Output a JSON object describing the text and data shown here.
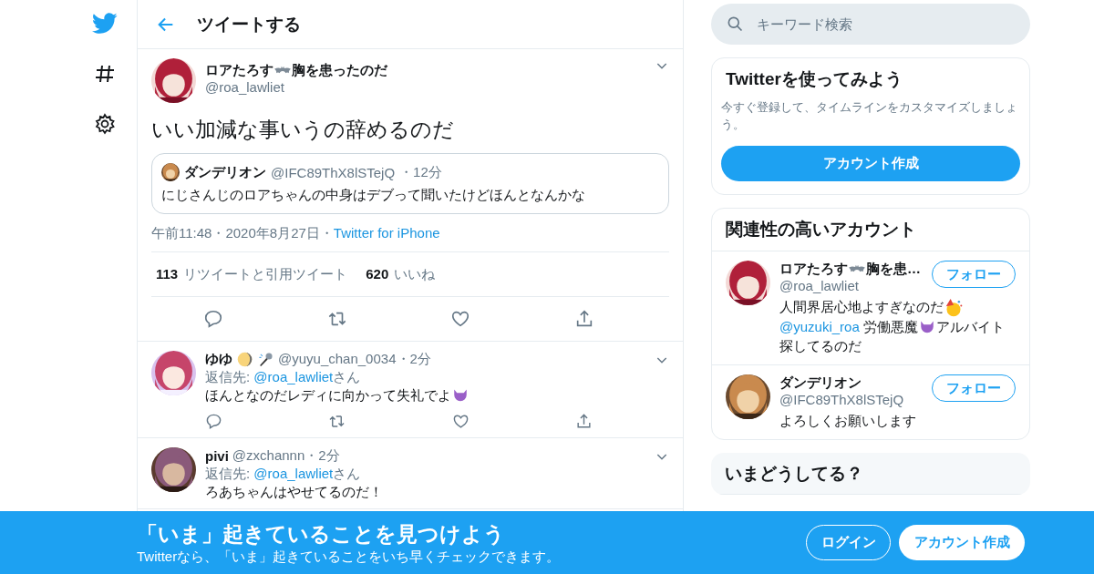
{
  "header": {
    "title": "ツイートする"
  },
  "tweet": {
    "name": "ロアたろす",
    "name_suffix": "胸を患ったのだ",
    "handle": "@roa_lawliet",
    "text": "いい加減な事いうの辞めるのだ",
    "quote": {
      "name": "ダンデリオン",
      "handle": "@IFC89ThX8lSTejQ",
      "time": "・12分",
      "text": "にじさんじのロアちゃんの中身はデブって聞いたけどほんとなんかな"
    },
    "time": "午前11:48",
    "date": "・2020年8月27日・",
    "source": "Twitter for iPhone",
    "stats": [
      {
        "count": "113",
        "label": "リツイートと引用ツイート"
      },
      {
        "count": "620",
        "label": "いいね"
      }
    ]
  },
  "replies": [
    {
      "name": "ゆゆ",
      "handle": "@yuyu_chan_0034",
      "time": "・2分",
      "reply_label": "返信先: ",
      "reply_to": "@roa_lawliet",
      "reply_suffix": "さん",
      "text": "ほんとなのだレディに向かって失礼でよ",
      "actions": true
    },
    {
      "name": "pivi",
      "handle": "@zxchannn",
      "time": "・2分",
      "reply_label": "返信先: ",
      "reply_to": "@roa_lawliet",
      "reply_suffix": "さん",
      "text": "ろあちゃんはやせてるのだ！",
      "actions": false
    }
  ],
  "search": {
    "placeholder": "キーワード検索"
  },
  "signup": {
    "title": "Twitterを使ってみよう",
    "text": "今すぐ登録して、タイムラインをカスタマイズしましょう。",
    "button": "アカウント作成"
  },
  "related": {
    "title": "関連性の高いアカウント",
    "accounts": [
      {
        "name": "ロアたろす",
        "name_suffix": "胸を患…",
        "handle": "@roa_lawliet",
        "button": "フォロー",
        "bio_1": "人間界居心地よすぎなのだ",
        "mention": "@yuzuki_roa",
        "bio_2": " 労働悪魔",
        "bio_3": "アルバイト探してるのだ"
      },
      {
        "name": "ダンデリオン",
        "handle": "@IFC89ThX8lSTejQ",
        "button": "フォロー",
        "bio_1": "よろしくお願いします"
      }
    ]
  },
  "trends": {
    "title": "いまどうしてる？"
  },
  "banner": {
    "title": "「いま」起きていることを見つけよう",
    "text": "Twitterなら、「いま」起きていることをいち早くチェックできます。",
    "login": "ログイン",
    "signup": "アカウント作成"
  }
}
